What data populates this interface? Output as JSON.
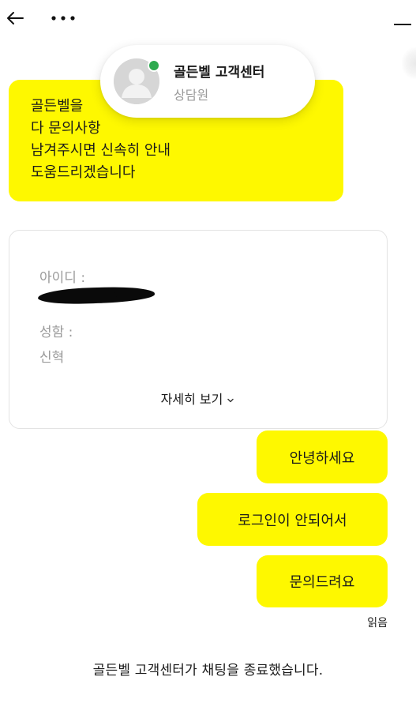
{
  "agent": {
    "name": "골든벨 고객센터",
    "role": "상담원"
  },
  "greeting": {
    "lines": [
      "골든벨을",
      "다 문의사항",
      "남겨주시면 신속히 안내",
      "도움드리겠습니다"
    ]
  },
  "info_card": {
    "id_label": "아이디 :",
    "name_label": "성함 :",
    "name_value": "신혁",
    "details_label": "자세히 보기"
  },
  "user_messages": [
    "안녕하세요",
    "로그인이 안되어서",
    "문의드려요"
  ],
  "read_receipt": "읽음",
  "end_notice": "골든벨 고객센터가 채팅을 종료했습니다.",
  "colors": {
    "bubble_yellow": "#fef800",
    "online_green": "#2eaa4f",
    "muted_text": "#9a9a9a"
  }
}
